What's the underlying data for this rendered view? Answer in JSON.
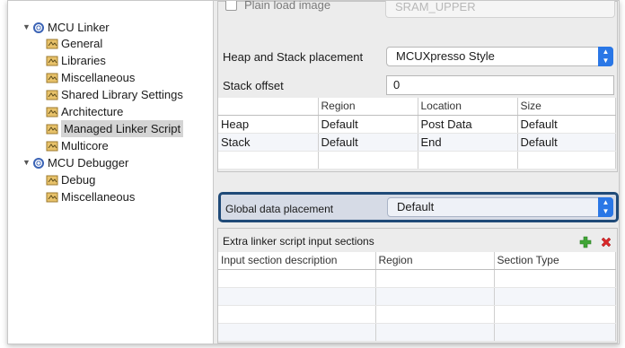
{
  "tree": {
    "items": [
      {
        "label": "MCU Linker"
      },
      {
        "label": "General"
      },
      {
        "label": "Libraries"
      },
      {
        "label": "Miscellaneous"
      },
      {
        "label": "Shared Library Settings"
      },
      {
        "label": "Architecture"
      },
      {
        "label": "Managed Linker Script"
      },
      {
        "label": "Multicore"
      },
      {
        "label": "MCU Debugger"
      },
      {
        "label": "Debug"
      },
      {
        "label": "Miscellaneous"
      }
    ]
  },
  "linker": {
    "plain_load_label": "Plain load image",
    "plain_load_value": "SRAM_UPPER",
    "heap_stack_label": "Heap and Stack placement",
    "heap_stack_value": "MCUXpresso Style",
    "stack_offset_label": "Stack offset",
    "stack_offset_value": "0",
    "table": {
      "columns": [
        "",
        "Region",
        "Location",
        "Size"
      ],
      "rows": [
        [
          "Heap",
          "Default",
          "Post Data",
          "Default"
        ],
        [
          "Stack",
          "Default",
          "End",
          "Default"
        ]
      ]
    }
  },
  "global": {
    "label": "Global data placement",
    "value": "Default"
  },
  "extra": {
    "title": "Extra linker script input sections",
    "columns": [
      "Input section description",
      "Region",
      "Section Type"
    ]
  },
  "colors": {
    "accent": "#2a77e6",
    "highlight_border": "#1f4a78",
    "add": "#3fa535",
    "remove": "#d8282a"
  }
}
